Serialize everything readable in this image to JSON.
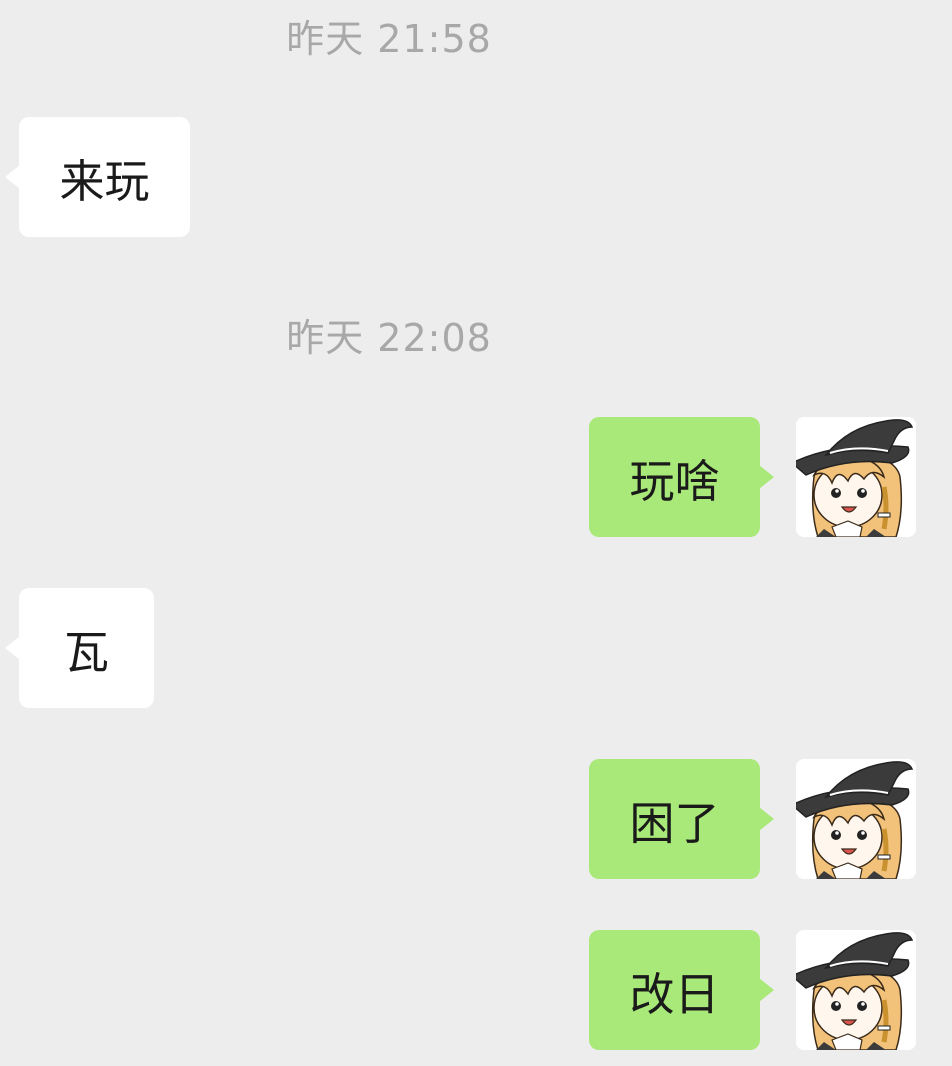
{
  "chat": {
    "timestamps": [
      "昨天 21:58",
      "昨天 22:08"
    ],
    "messages": [
      {
        "side": "incoming",
        "text": "来玩"
      },
      {
        "side": "outgoing",
        "text": "玩啥"
      },
      {
        "side": "incoming",
        "text": "瓦"
      },
      {
        "side": "outgoing",
        "text": "困了"
      },
      {
        "side": "outgoing",
        "text": "改日"
      }
    ]
  },
  "colors": {
    "background": "#ededed",
    "incoming_bubble": "#ffffff",
    "outgoing_bubble": "#a9e979",
    "timestamp_text": "#a8a8a8"
  },
  "avatar": {
    "icon": "witch-girl-avatar-icon"
  }
}
